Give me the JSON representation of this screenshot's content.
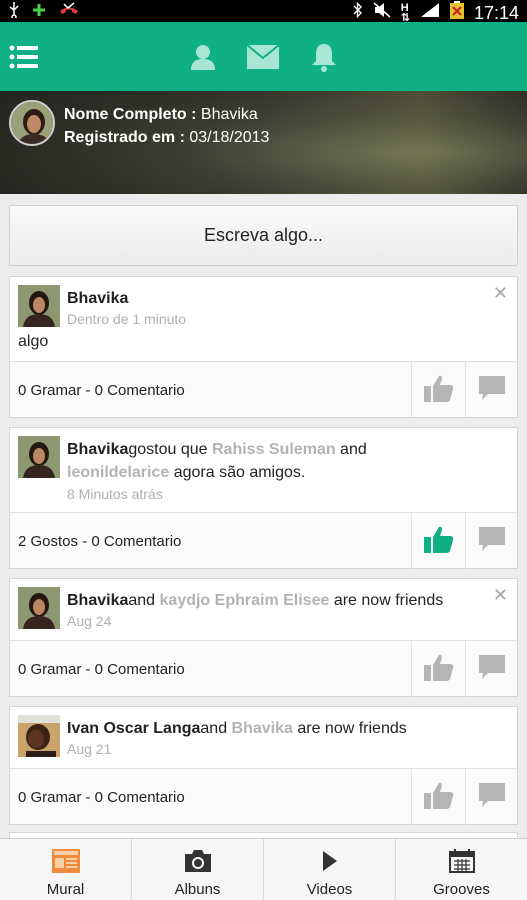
{
  "status_bar": {
    "time": "17:14",
    "icons": [
      "usb-icon",
      "plus-icon",
      "missed-call-icon",
      "bluetooth-icon",
      "mute-icon",
      "hspa-icon",
      "signal-icon",
      "battery-icon"
    ]
  },
  "app_bar": {
    "accent": "#0fb083",
    "icons": [
      "menu-icon",
      "profile-icon",
      "mail-icon",
      "bell-icon"
    ]
  },
  "profile": {
    "name_label": "Nome Completo :",
    "name_value": "Bhavika",
    "registered_label": "Registrado em :",
    "registered_value": "03/18/2013"
  },
  "composer": {
    "placeholder": "Escreva algo..."
  },
  "feed": [
    {
      "author": "Bhavika",
      "time": "Dentro de 1 minuto",
      "body": "algo",
      "stats": "0 Gramar - 0 Comentario",
      "liked": false,
      "closable": true
    },
    {
      "author": "Bhavika",
      "mid1": "gostou que ",
      "link1": "Rahiss Suleman",
      "mid2": " and ",
      "link2": "leonildelarice",
      "mid3": " agora são amigos.",
      "time": "8 Minutos atrás",
      "stats": "2 Gostos - 0 Comentario",
      "liked": true
    },
    {
      "author": "Bhavika",
      "mid1": "and ",
      "link1": "kaydjo Ephraim Elisee",
      "mid2": " are now friends",
      "time": "Aug 24",
      "stats": "0 Gramar - 0 Comentario",
      "liked": false,
      "closable": true
    },
    {
      "author": "Ivan Oscar Langa",
      "mid1": "and ",
      "link1": "Bhavika",
      "mid2": " are now friends",
      "time": "Aug 21",
      "stats": "0 Gramar - 0 Comentario",
      "liked": false
    }
  ],
  "bottom_nav": [
    {
      "label": "Mural",
      "icon": "newspaper-icon",
      "active": true
    },
    {
      "label": "Albuns",
      "icon": "camera-icon"
    },
    {
      "label": "Videos",
      "icon": "play-icon"
    },
    {
      "label": "Grooves",
      "icon": "calendar-icon"
    }
  ],
  "colors": {
    "like_active": "#0fb083",
    "like_inactive": "#b5b5b5",
    "link_gray": "#b3b3b3",
    "nav_active": "#f08a3c"
  }
}
